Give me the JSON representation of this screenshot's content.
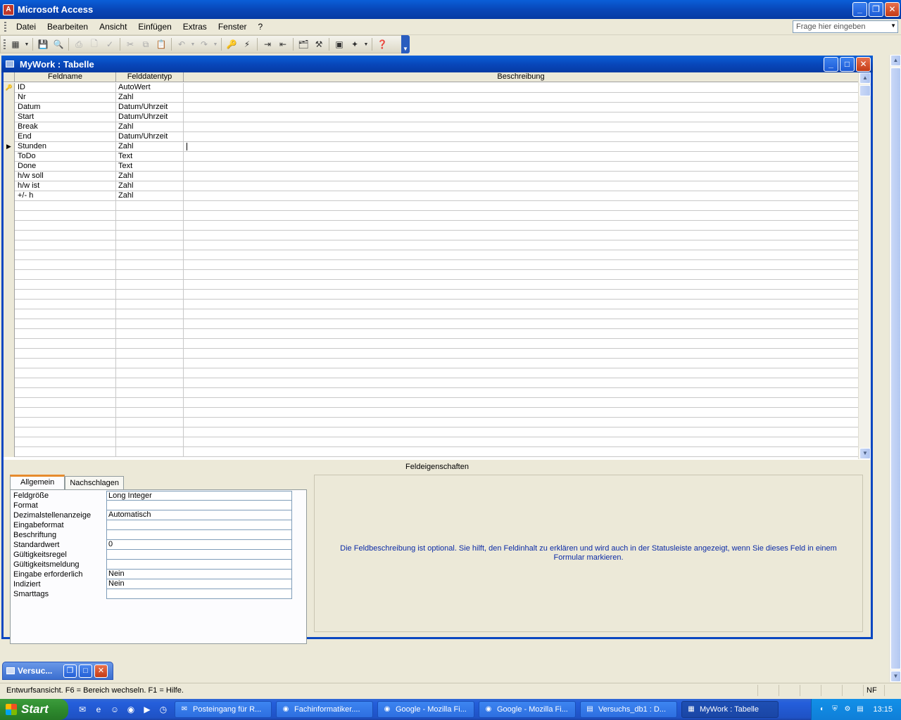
{
  "app": {
    "title": "Microsoft Access",
    "logo_letter": "A"
  },
  "menu": {
    "items": [
      "Datei",
      "Bearbeiten",
      "Ansicht",
      "Einfügen",
      "Extras",
      "Fenster",
      "?"
    ],
    "help_placeholder": "Frage hier eingeben"
  },
  "window": {
    "title": "MyWork : Tabelle"
  },
  "grid": {
    "headers": [
      "Feldname",
      "Felddatentyp",
      "Beschreibung"
    ],
    "rows": [
      {
        "name": "ID",
        "type": "AutoWert",
        "desc": "",
        "key": true,
        "current": false
      },
      {
        "name": "Nr",
        "type": "Zahl",
        "desc": "",
        "key": false,
        "current": false
      },
      {
        "name": "Datum",
        "type": "Datum/Uhrzeit",
        "desc": "",
        "key": false,
        "current": false
      },
      {
        "name": "Start",
        "type": "Datum/Uhrzeit",
        "desc": "",
        "key": false,
        "current": false
      },
      {
        "name": "Break",
        "type": "Zahl",
        "desc": "",
        "key": false,
        "current": false
      },
      {
        "name": "End",
        "type": "Datum/Uhrzeit",
        "desc": "",
        "key": false,
        "current": false
      },
      {
        "name": "Stunden",
        "type": "Zahl",
        "desc": "",
        "key": false,
        "current": true
      },
      {
        "name": "ToDo",
        "type": "Text",
        "desc": "",
        "key": false,
        "current": false
      },
      {
        "name": "Done",
        "type": "Text",
        "desc": "",
        "key": false,
        "current": false
      },
      {
        "name": "h/w soll",
        "type": "Zahl",
        "desc": "",
        "key": false,
        "current": false
      },
      {
        "name": "h/w ist",
        "type": "Zahl",
        "desc": "",
        "key": false,
        "current": false
      },
      {
        "name": "+/- h",
        "type": "Zahl",
        "desc": "",
        "key": false,
        "current": false
      }
    ],
    "empty_rows": 26
  },
  "properties": {
    "section_label": "Feldeigenschaften",
    "tabs": [
      "Allgemein",
      "Nachschlagen"
    ],
    "active_tab": 0,
    "fields": [
      {
        "label": "Feldgröße",
        "value": "Long Integer"
      },
      {
        "label": "Format",
        "value": ""
      },
      {
        "label": "Dezimalstellenanzeige",
        "value": "Automatisch"
      },
      {
        "label": "Eingabeformat",
        "value": ""
      },
      {
        "label": "Beschriftung",
        "value": ""
      },
      {
        "label": "Standardwert",
        "value": "0"
      },
      {
        "label": "Gültigkeitsregel",
        "value": ""
      },
      {
        "label": "Gültigkeitsmeldung",
        "value": ""
      },
      {
        "label": "Eingabe erforderlich",
        "value": "Nein"
      },
      {
        "label": "Indiziert",
        "value": "Nein"
      },
      {
        "label": "Smarttags",
        "value": ""
      }
    ],
    "help_text": "Die Feldbeschreibung ist optional. Sie hilft, den Feldinhalt zu erklären und wird auch in der Statusleiste angezeigt, wenn Sie dieses Feld in einem Formular markieren."
  },
  "minimized_window": {
    "title": "Versuc..."
  },
  "statusbar": {
    "message": "Entwurfsansicht. F6 = Bereich wechseln. F1 = Hilfe.",
    "indicator": "NF"
  },
  "taskbar": {
    "start_label": "Start",
    "tasks": [
      {
        "label": "Posteingang für R...",
        "icon": "mail-icon",
        "active": false
      },
      {
        "label": "Fachinformatiker....",
        "icon": "firefox-icon",
        "active": false
      },
      {
        "label": "Google - Mozilla Fi...",
        "icon": "firefox-icon",
        "active": false
      },
      {
        "label": "Google - Mozilla Fi...",
        "icon": "firefox-icon",
        "active": false
      },
      {
        "label": "Versuchs_db1 : D...",
        "icon": "database-icon",
        "active": false
      },
      {
        "label": "MyWork : Tabelle",
        "icon": "table-icon",
        "active": true
      }
    ],
    "clock": "13:15"
  },
  "colors": {
    "title_blue": "#0846b8",
    "help_text": "#0b2ba6",
    "tab_accent": "#e68b2c",
    "start_green": "#2e8a2e"
  }
}
